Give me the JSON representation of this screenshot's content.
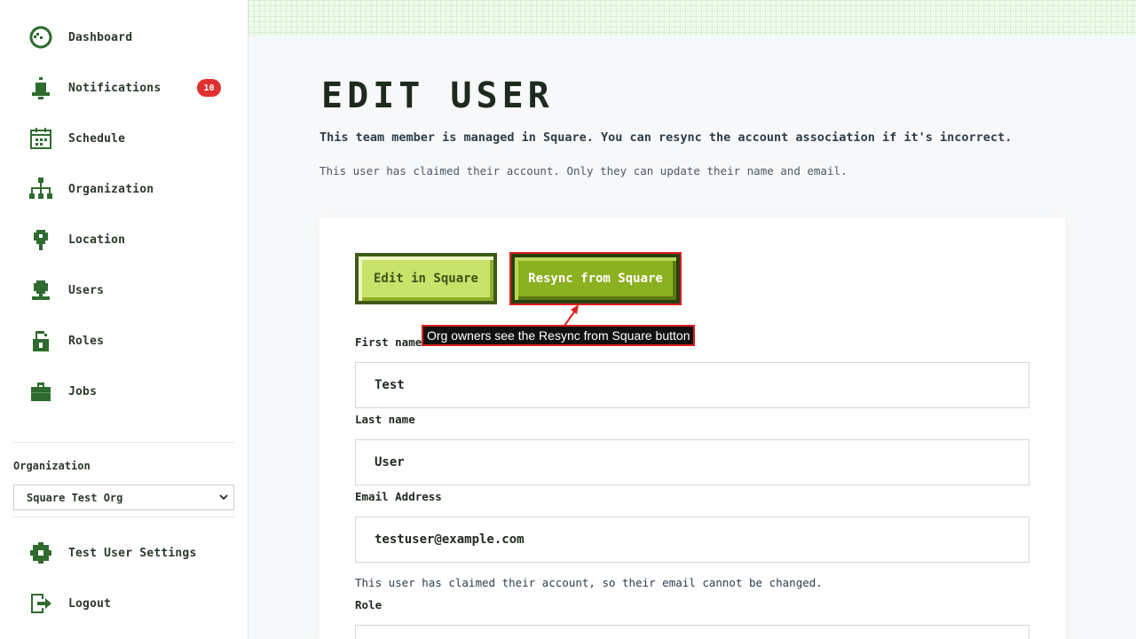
{
  "sidebar": {
    "items": [
      {
        "label": "Dashboard",
        "icon": "dashboard-icon"
      },
      {
        "label": "Notifications",
        "icon": "bell-icon",
        "badge": "10"
      },
      {
        "label": "Schedule",
        "icon": "calendar-icon"
      },
      {
        "label": "Organization",
        "icon": "org-chart-icon"
      },
      {
        "label": "Location",
        "icon": "location-pin-icon"
      },
      {
        "label": "Users",
        "icon": "user-icon"
      },
      {
        "label": "Roles",
        "icon": "unlock-icon"
      },
      {
        "label": "Jobs",
        "icon": "briefcase-icon"
      }
    ],
    "org_label": "Organization",
    "org_selected": "Square Test Org",
    "settings_label": "Test User Settings",
    "logout_label": "Logout"
  },
  "main": {
    "title": "EDIT USER",
    "intro": "This team member is managed in Square. You can resync the account association if it's incorrect.",
    "claimed_note": "This user has claimed their account. Only they can update their name and email.",
    "edit_in_square": "Edit in Square",
    "resync_from_square": "Resync from Square",
    "callout": "Org owners see the Resync from Square button",
    "fields": {
      "first_name_label": "First name",
      "first_name_value": "Test",
      "last_name_label": "Last name",
      "last_name_value": "User",
      "email_label": "Email Address",
      "email_value": "testuser@example.com",
      "email_help": "This user has claimed their account, so their email cannot be changed.",
      "role_label": "Role"
    }
  },
  "colors": {
    "icon_green": "#2f6b2f",
    "button_light": "#c9e26a",
    "button_dark": "#8bb020",
    "badge_red": "#e03131",
    "highlight_red": "#e02020"
  }
}
